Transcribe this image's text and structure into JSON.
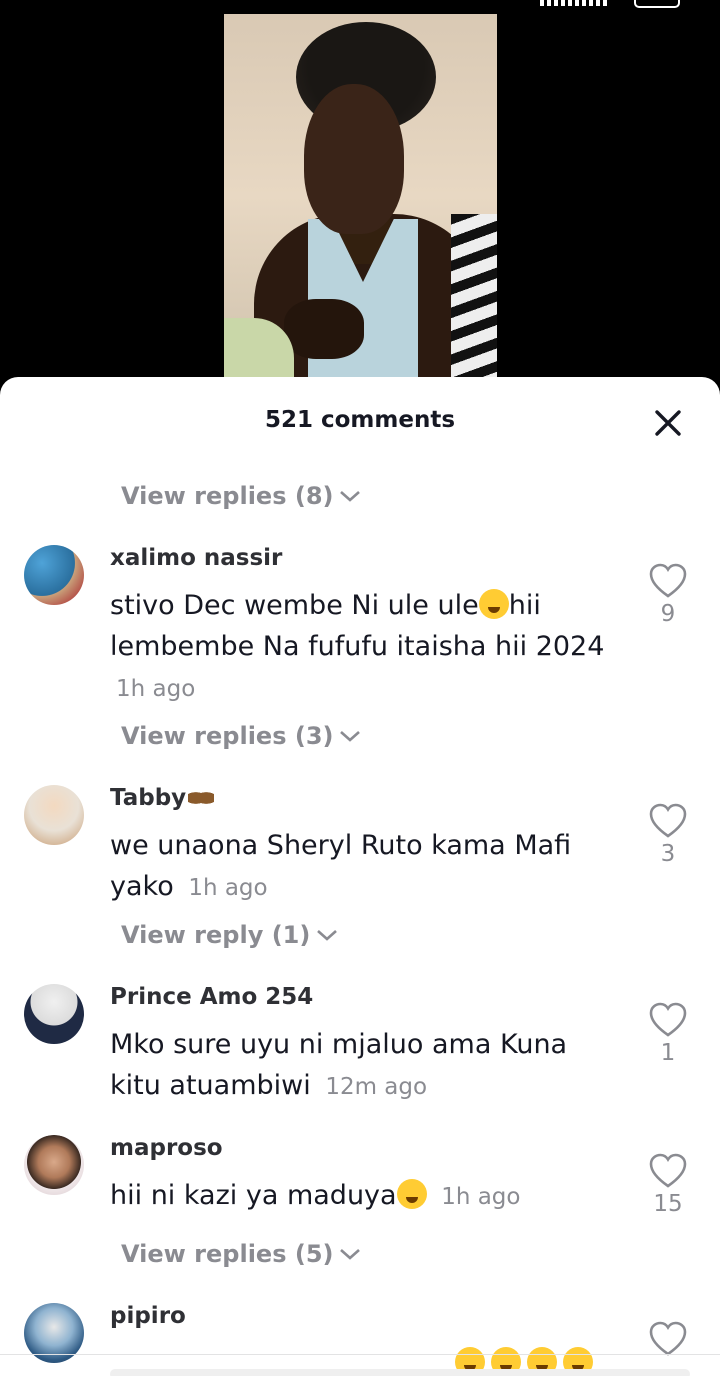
{
  "sheet": {
    "title": "521 comments"
  },
  "top_replies": {
    "label": "View replies (8)"
  },
  "comments": [
    {
      "username": "xalimo nassir",
      "text": "stivo Dec wembe Ni ule ule",
      "text2": "hii lembembe Na fufufu itaisha hii 2024",
      "time": "1h ago",
      "likes": "9",
      "replies_label": "View replies (3)"
    },
    {
      "username": "Tabby",
      "text": "we unaona Sheryl Ruto kama Mafi yako",
      "time": "1h ago",
      "likes": "3",
      "replies_label": "View reply (1)"
    },
    {
      "username": "Prince Amo 254",
      "text": "Mko sure uyu ni mjaluo ama Kuna kitu atuambiwi",
      "time": "12m ago",
      "likes": "1"
    },
    {
      "username": "maproso",
      "text": "hii ni kazi ya maduya",
      "time": "1h ago",
      "likes": "15",
      "replies_label": "View replies (5)"
    },
    {
      "username": "pipiro"
    }
  ],
  "icons": {
    "like": "heart-outline-icon",
    "close": "close-icon",
    "chevron": "chevron-down-icon"
  }
}
